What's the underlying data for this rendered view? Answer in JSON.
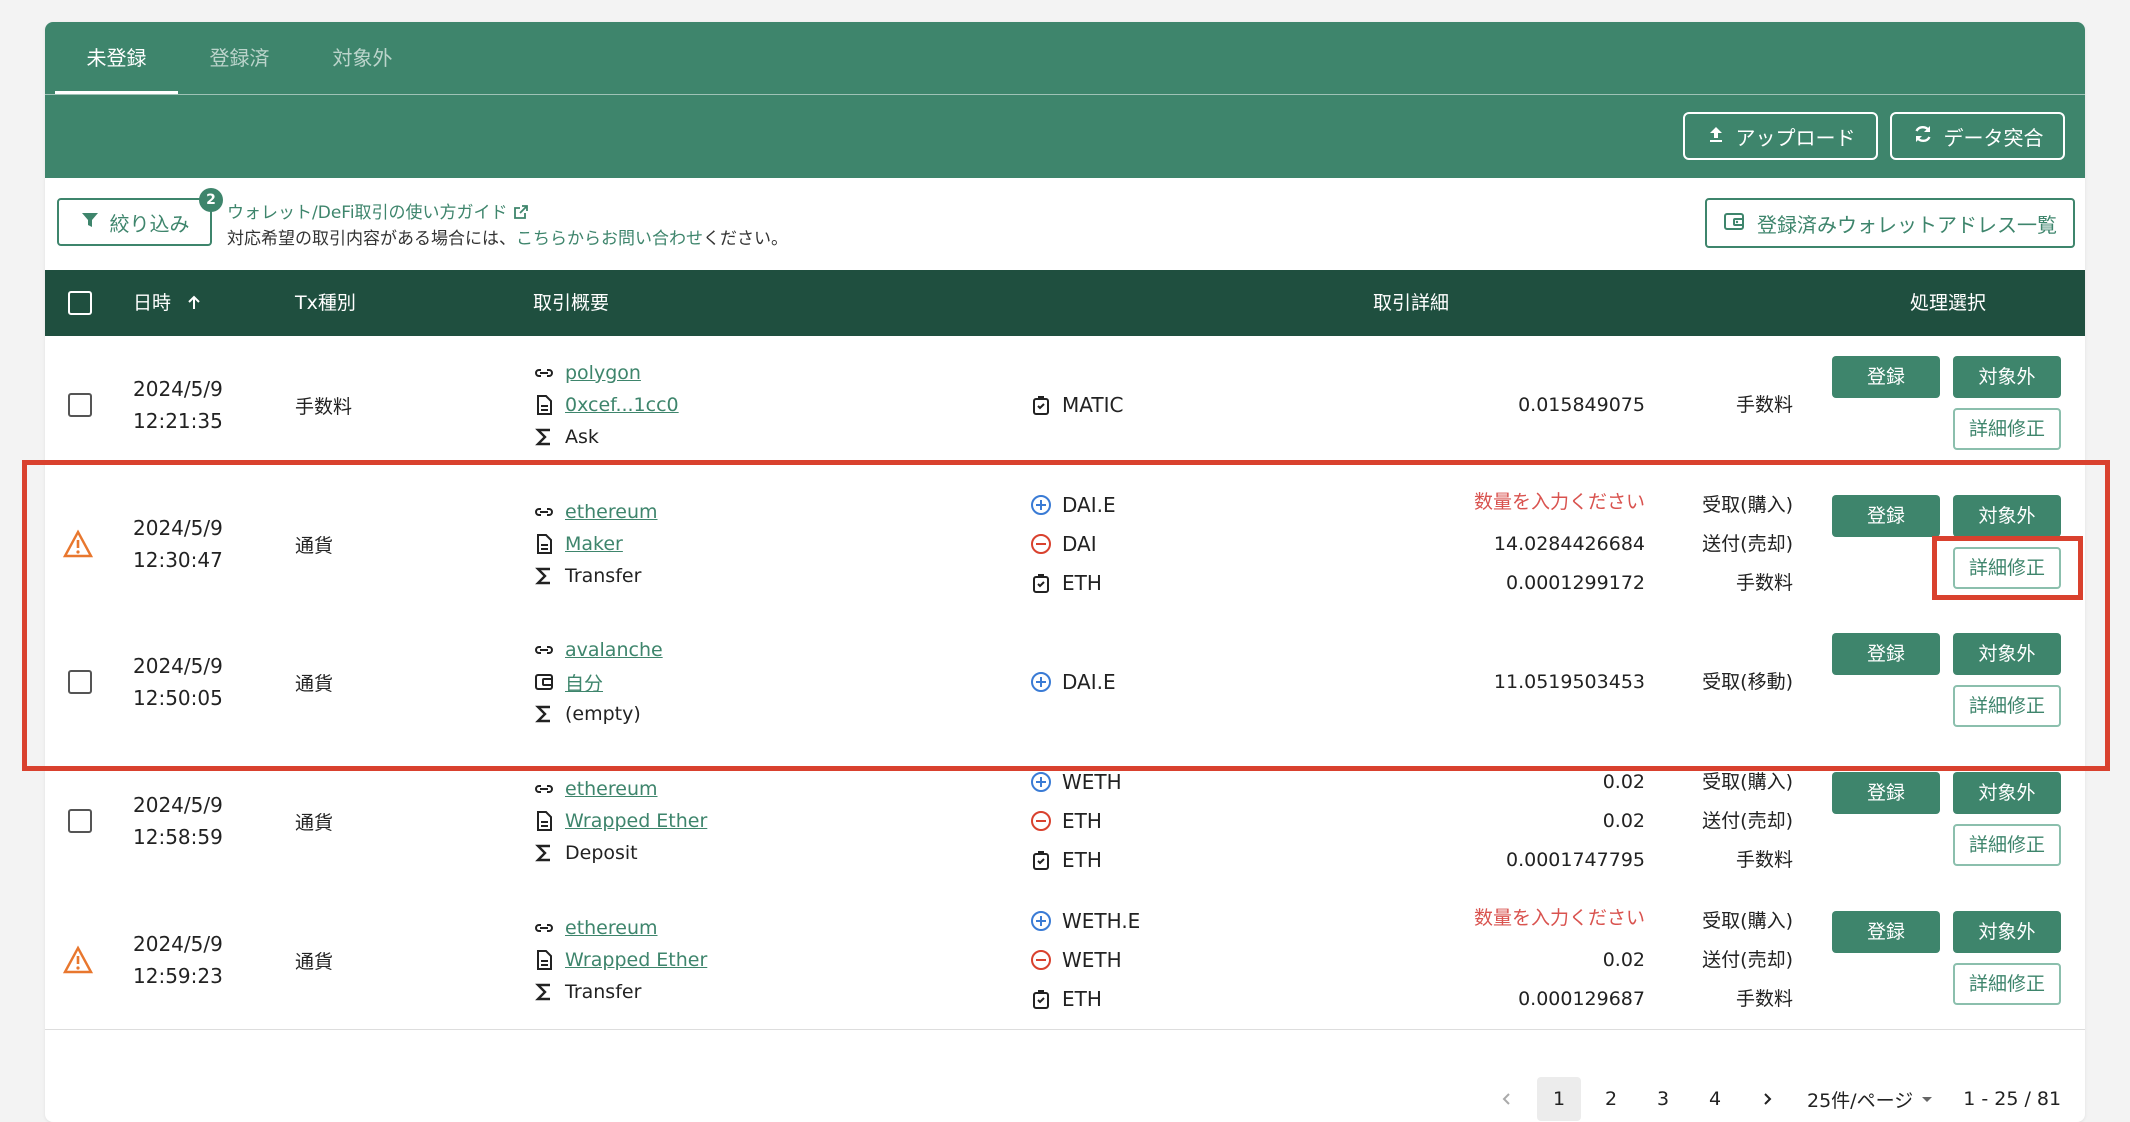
{
  "tabs": [
    "未登録",
    "登録済",
    "対象外"
  ],
  "header_buttons": {
    "upload": "アップロード",
    "reconcile": "データ突合"
  },
  "filter": {
    "label": "絞り込み",
    "badge": "2"
  },
  "guide_link": "ウォレット/DeFi取引の使い方ガイド",
  "notice": {
    "pre": "対応希望の取引内容がある場合には、",
    "link": "こちらからお問い合わせ",
    "post": "ください。"
  },
  "wallet_list_button": "登録済みウォレットアドレス一覧",
  "columns": {
    "datetime": "日時",
    "tx_type": "Tx種別",
    "summary": "取引概要",
    "detail": "取引詳細",
    "action": "処理選択"
  },
  "action_labels": {
    "register": "登録",
    "exclude": "対象外",
    "edit": "詳細修正"
  },
  "rows": [
    {
      "date": "2024/5/9",
      "time": "12:21:35",
      "type": "手数料",
      "warning": false,
      "chain": "polygon",
      "contract": "0xcef...1cc0",
      "method": "Ask",
      "lines": [
        {
          "icon": "fee",
          "asset": "MATIC",
          "amount": "0.015849075",
          "class": "手数料"
        }
      ]
    },
    {
      "date": "2024/5/9",
      "time": "12:30:47",
      "type": "通貨",
      "warning": true,
      "chain": "ethereum",
      "contract": "Maker",
      "method": "Transfer",
      "lines": [
        {
          "icon": "plus",
          "asset": "DAI.E",
          "amount": "数量を入力ください",
          "class": "受取(購入)",
          "error": true
        },
        {
          "icon": "minus",
          "asset": "DAI",
          "amount": "14.0284426684",
          "class": "送付(売却)"
        },
        {
          "icon": "fee",
          "asset": "ETH",
          "amount": "0.0001299172",
          "class": "手数料"
        }
      ]
    },
    {
      "date": "2024/5/9",
      "time": "12:50:05",
      "type": "通貨",
      "warning": false,
      "chain": "avalanche",
      "contract": "自分",
      "method": "(empty)",
      "lines": [
        {
          "icon": "plus",
          "asset": "DAI.E",
          "amount": "11.0519503453",
          "class": "受取(移動)"
        }
      ]
    },
    {
      "date": "2024/5/9",
      "time": "12:58:59",
      "type": "通貨",
      "warning": false,
      "chain": "ethereum",
      "contract": "Wrapped Ether",
      "method": "Deposit",
      "lines": [
        {
          "icon": "plus",
          "asset": "WETH",
          "amount": "0.02",
          "class": "受取(購入)"
        },
        {
          "icon": "minus",
          "asset": "ETH",
          "amount": "0.02",
          "class": "送付(売却)"
        },
        {
          "icon": "fee",
          "asset": "ETH",
          "amount": "0.0001747795",
          "class": "手数料"
        }
      ]
    },
    {
      "date": "2024/5/9",
      "time": "12:59:23",
      "type": "通貨",
      "warning": true,
      "chain": "ethereum",
      "contract": "Wrapped Ether",
      "method": "Transfer",
      "lines": [
        {
          "icon": "plus",
          "asset": "WETH.E",
          "amount": "数量を入力ください",
          "class": "受取(購入)",
          "error": true
        },
        {
          "icon": "minus",
          "asset": "WETH",
          "amount": "0.02",
          "class": "送付(売却)"
        },
        {
          "icon": "fee",
          "asset": "ETH",
          "amount": "0.000129687",
          "class": "手数料"
        }
      ]
    }
  ],
  "pagination": {
    "pages": [
      "1",
      "2",
      "3",
      "4"
    ],
    "current": "1",
    "per_page": "25件/ページ",
    "range": "1 - 25 / 81"
  },
  "colors": {
    "brand": "#3e856c",
    "header_dark": "#1f4f3f",
    "error": "#d9534f",
    "highlight": "#d9412e"
  }
}
